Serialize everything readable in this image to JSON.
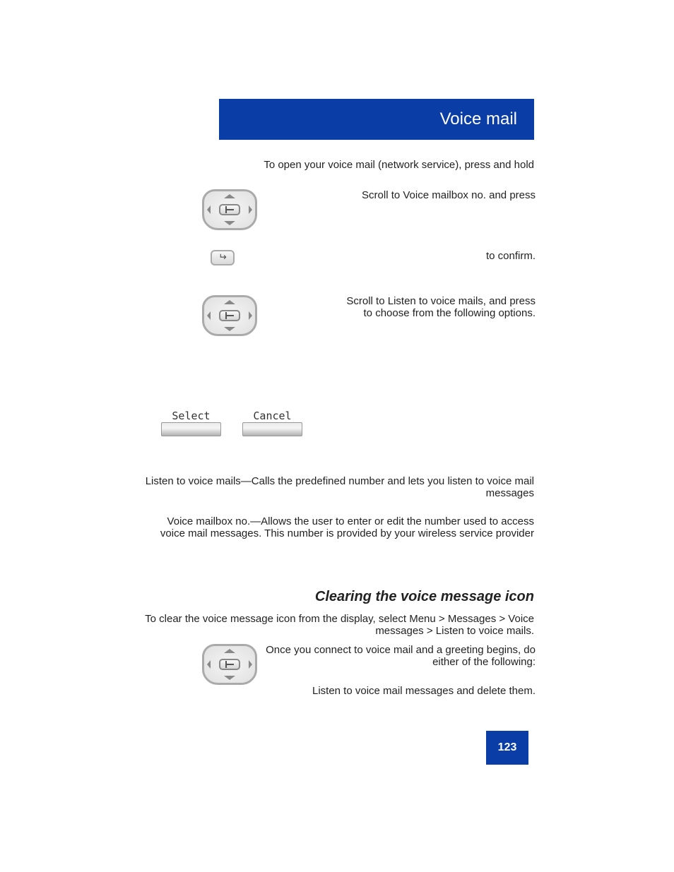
{
  "banner": {
    "title": "Voice mail"
  },
  "intro": "To open your voice mail (network service), press and hold",
  "step_1_text": "Scroll to Voice mailbox no. and press",
  "step_2_text": "to confirm.",
  "step_3_line1": "Scroll to Listen to voice mails, and press",
  "step_3_line2": "to choose from the following options.",
  "softkeys": {
    "left": "Select",
    "right": "Cancel"
  },
  "bullet1": "Listen to voice mails—Calls the predefined number and lets you listen to voice mail messages",
  "bullet2": "Voice mailbox no.—Allows the user to enter or edit the number used to access voice mail messages. This number is provided by your wireless service provider",
  "section2_title": "Clearing the voice message icon",
  "section2_intro": "To clear the voice message icon from the display, select Menu > Messages > Voice messages > Listen to voice mails.",
  "step_4_line1": "Once you connect to voice mail and a greeting begins, do either of the following:",
  "step_4_line2": "Listen to voice mail messages and delete them.",
  "pagenum": "123"
}
